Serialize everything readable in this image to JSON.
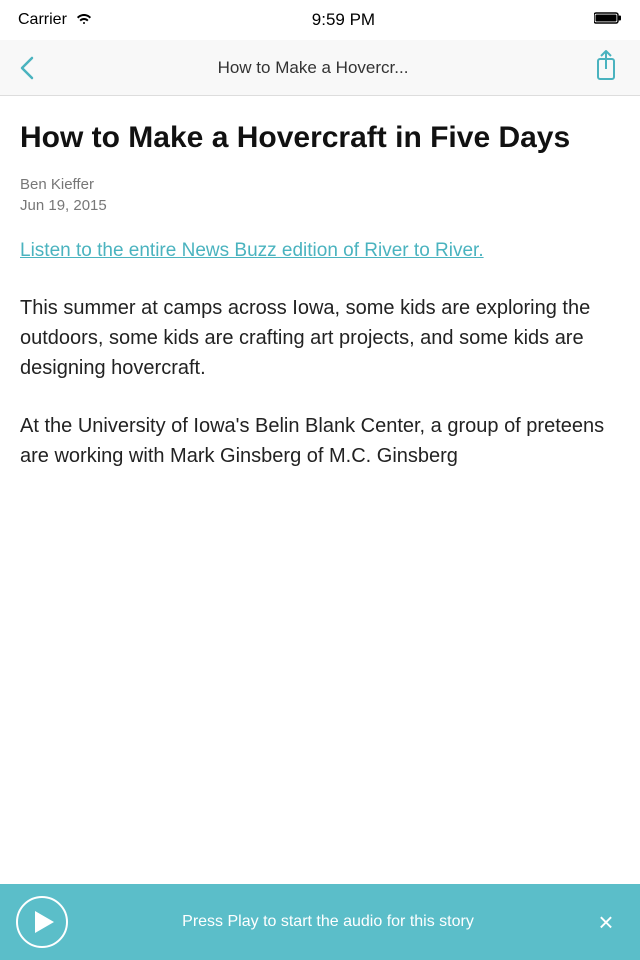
{
  "status_bar": {
    "carrier": "Carrier",
    "time": "9:59 PM"
  },
  "nav": {
    "back_label": "<",
    "title": "How to Make a Hovercr...",
    "share_label": "⬆"
  },
  "article": {
    "title": "How to Make a Hovercraft in Five Days",
    "author": "Ben Kieffer",
    "date": "Jun 19, 2015",
    "link_text": "Listen to the entire News Buzz edition of River to River.",
    "body_paragraph_1": "This summer at camps across Iowa, some kids are exploring the outdoors, some kids are crafting art projects, and some kids are designing hovercraft.",
    "body_paragraph_2": "At the University of Iowa's Belin Blank Center, a group of preteens are working with Mark Ginsberg of M.C. Ginsberg"
  },
  "audio_player": {
    "text_line1": "Press Play to start the",
    "text_line2": "audio for this story",
    "full_text": "Press Play to start the audio for this story"
  },
  "colors": {
    "link": "#4ab3bf",
    "audio_bg": "#5bbec9"
  }
}
